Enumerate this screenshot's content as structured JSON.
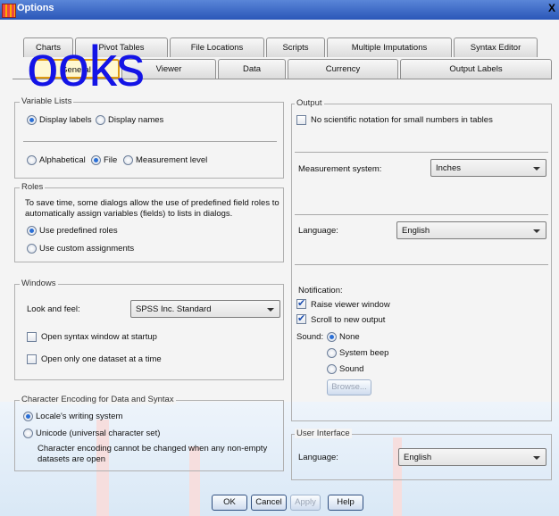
{
  "window": {
    "title": "Options",
    "close_glyph": "X"
  },
  "tabs_row1": [
    "Charts",
    "Pivot Tables",
    "File Locations",
    "Scripts",
    "Multiple Imputations",
    "Syntax Editor"
  ],
  "tabs_row2": [
    "General",
    "Viewer",
    "Data",
    "Currency",
    "Output Labels"
  ],
  "active_tab": "General",
  "watermark": "ooks",
  "variable_lists": {
    "legend": "Variable Lists",
    "display_labels": "Display labels",
    "display_names": "Display names",
    "alphabetical": "Alphabetical",
    "file": "File",
    "measurement_level": "Measurement level"
  },
  "roles": {
    "legend": "Roles",
    "description": "To save time, some dialogs allow the use of predefined field roles to automatically assign variables (fields) to lists in dialogs.",
    "use_predefined": "Use predefined roles",
    "use_custom": "Use custom assignments"
  },
  "windows": {
    "legend": "Windows",
    "look_feel_label": "Look and feel:",
    "look_feel_value": "SPSS Inc. Standard",
    "open_syntax": "Open syntax window at startup",
    "open_one_dataset": "Open only one dataset at a time"
  },
  "encoding": {
    "legend": "Character Encoding for Data and Syntax",
    "locale": "Locale's writing system",
    "unicode": "Unicode (universal character set)",
    "note": "Character encoding cannot be changed when any non-empty datasets are open"
  },
  "output": {
    "legend": "Output",
    "no_scientific": "No scientific notation for small numbers in tables",
    "measurement_label": "Measurement system:",
    "measurement_value": "Inches",
    "language_label": "Language:",
    "language_value": "English"
  },
  "notification": {
    "label": "Notification:",
    "raise_viewer": "Raise viewer window",
    "scroll_output": "Scroll to new output",
    "sound_label": "Sound:",
    "none": "None",
    "system_beep": "System beep",
    "sound": "Sound",
    "browse": "Browse..."
  },
  "user_interface": {
    "legend": "User Interface",
    "language_label": "Language:",
    "language_value": "English"
  },
  "buttons": {
    "ok": "OK",
    "cancel": "Cancel",
    "apply": "Apply",
    "help": "Help"
  }
}
